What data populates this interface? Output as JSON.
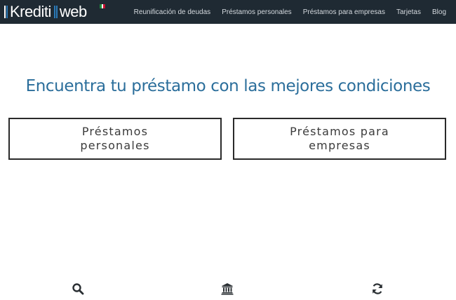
{
  "brand": {
    "name_part1": "Krediti",
    "name_part2": "web",
    "colors": {
      "bar1": "#ffffff",
      "bar2": "#2b7ab8",
      "flag_green": "#1d8a3a",
      "flag_white": "#ffffff",
      "flag_red": "#c8102e"
    }
  },
  "nav": {
    "items": [
      {
        "label": "Reunificación de deudas"
      },
      {
        "label": "Préstamos personales"
      },
      {
        "label": "Préstamos para empresas"
      },
      {
        "label": "Tarjetas"
      },
      {
        "label": "Blog"
      }
    ]
  },
  "hero": {
    "title": "Encuentra tu préstamo con las mejores condiciones"
  },
  "cards": {
    "personal_label": "Préstamos personales",
    "business_label": "Préstamos para empresas"
  },
  "features": {
    "icons": [
      "search-icon",
      "bank-icon",
      "refresh-icon"
    ]
  },
  "colors": {
    "navbar_bg": "#1f2a33",
    "headline": "#2b6e9b",
    "card_border": "#2a2a2a"
  }
}
